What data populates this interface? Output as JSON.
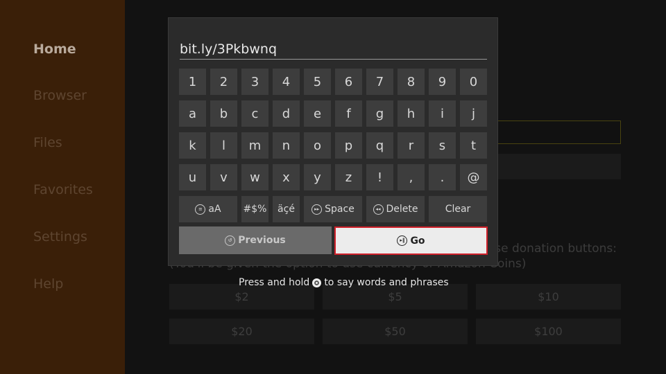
{
  "sidebar": {
    "items": [
      {
        "label": "Home",
        "active": true
      },
      {
        "label": "Browser"
      },
      {
        "label": "Files"
      },
      {
        "label": "Favorites"
      },
      {
        "label": "Settings"
      },
      {
        "label": "Help"
      }
    ]
  },
  "background": {
    "donation_text": "ase donation buttons:",
    "donation_subtext": "(You'll be given the option to use currency or Amazon Coins)",
    "donations": [
      "$2",
      "$5",
      "$10",
      "$20",
      "$50",
      "$100"
    ]
  },
  "keyboard": {
    "input_value": "bit.ly/3Pkbwnq",
    "rows": [
      [
        "1",
        "2",
        "3",
        "4",
        "5",
        "6",
        "7",
        "8",
        "9",
        "0"
      ],
      [
        "a",
        "b",
        "c",
        "d",
        "e",
        "f",
        "g",
        "h",
        "i",
        "j"
      ],
      [
        "k",
        "l",
        "m",
        "n",
        "o",
        "p",
        "q",
        "r",
        "s",
        "t"
      ],
      [
        "u",
        "v",
        "w",
        "x",
        "y",
        "z",
        "!",
        ",",
        ".",
        "@"
      ]
    ],
    "case_label": "aA",
    "symbols_label": "#$%",
    "accents_label": "äçé",
    "space_label": "Space",
    "delete_label": "Delete",
    "clear_label": "Clear",
    "previous_label": "Previous",
    "go_label": "Go",
    "hint_before": "Press and hold",
    "hint_after": "to say words and phrases",
    "accent_color": "#d0202a"
  }
}
